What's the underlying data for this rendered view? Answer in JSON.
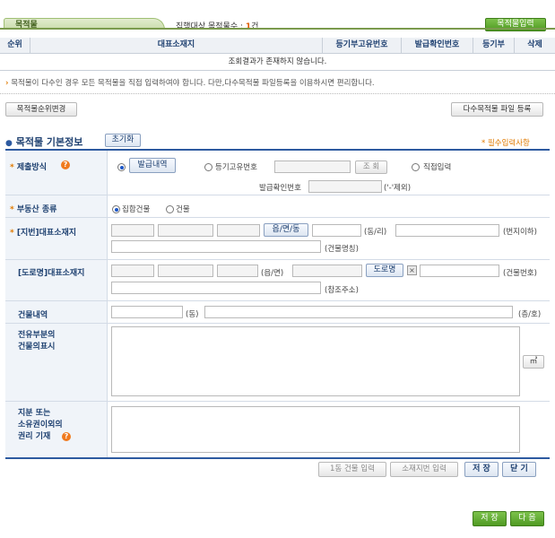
{
  "tab": {
    "label": "목적물"
  },
  "summary": {
    "prefix": "집행대상 목적물수 : ",
    "count": "1",
    "suffix": "건"
  },
  "buttons": {
    "add_item": "목적물입력",
    "change_order": "목적물순위변경",
    "bulk_upload": "다수목적물 파일 등록",
    "reset": "초기화",
    "issuance_history": "발급내역",
    "lookup": "조 회",
    "town": "읍/면/동",
    "road_name": "도로명",
    "unit_area": "㎡",
    "building_input": "1동 건물 입력",
    "lot_input": "소재지번 입력",
    "save_small": "저 장",
    "close": "닫 기",
    "save": "저 장",
    "next": "다 음"
  },
  "table": {
    "headers": [
      "순위",
      "대표소재지",
      "등기부고유번호",
      "발급확인번호",
      "등기부",
      "삭제"
    ],
    "empty_message": "조회결과가 존재하지 않습니다."
  },
  "note": "목적물이 다수인 경우 모든 목적물을 직접 입력하여야 합니다. 다만,다수목적물 파일등록을 이용하시면 편리합니다.",
  "form": {
    "title": "목적물 기본정보",
    "required_note": "* 필수입력사항",
    "submission": {
      "label": "제출방식",
      "opt_registry_no": "등기고유번호",
      "opt_direct": "직접입력",
      "issue_confirm_label": "발급확인번호",
      "issue_confirm_hint": "('-'제외)",
      "selected": "발급내역"
    },
    "property_type": {
      "label": "부동산 종류",
      "options": [
        "집합건물",
        "건물"
      ],
      "selected": "집합건물"
    },
    "lot_address": {
      "label": "[지번]대표소재지",
      "ri": "(동/리)",
      "lot_below": "(번지이하)",
      "building_name": "(건물명칭)"
    },
    "road_address": {
      "label": "[도로명]대표소재지",
      "town": "(읍/면)",
      "building_no": "(건물번호)",
      "ref_address": "(참조주소)"
    },
    "building_details": {
      "label": "건물내역",
      "dong": "(동)",
      "floor_ho": "(층/호)"
    },
    "exclusive_part": {
      "label_line1": "전유부분의",
      "label_line2": "건물의표시"
    },
    "share": {
      "label_line1": "지분 또는",
      "label_line2": "소유권이외의",
      "label_line3": "권리 기재"
    }
  }
}
